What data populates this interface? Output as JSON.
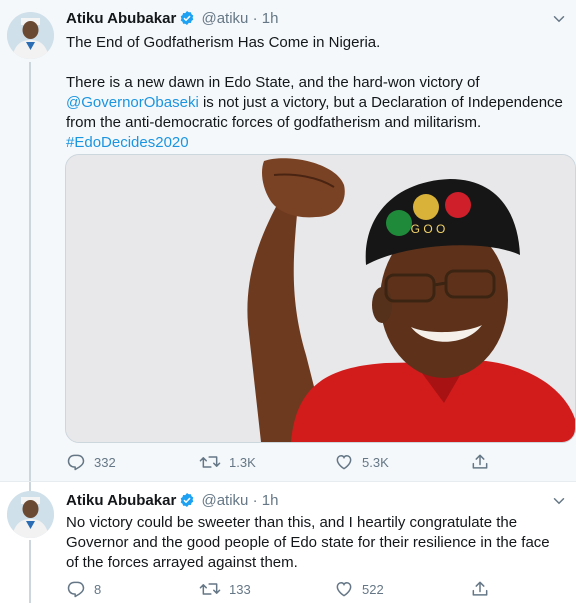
{
  "tweets": [
    {
      "author_name": "Atiku Abubakar",
      "handle": "@atiku",
      "separator": "·",
      "time": "1h",
      "text_line1": "The End of Godfatherism Has Come in Nigeria.",
      "text_p2_a": "There is a new dawn in Edo State, and the hard-won victory of",
      "mention": "@GovernorObaseki",
      "text_p2_b": " is not just a victory, but a Declaration of Independence from the anti-democratic forces of godfatherism and militarism.",
      "hashtag": "#EdoDecides2020",
      "image_cap_text": "G O O",
      "replies": "332",
      "retweets": "1.3K",
      "likes": "5.3K"
    },
    {
      "author_name": "Atiku Abubakar",
      "handle": "@atiku",
      "separator": "·",
      "time": "1h",
      "text": "No victory could be sweeter than this, and I heartily congratulate the Governor and the good people of Edo state for their resilience in the face of the forces arrayed against them.",
      "replies": "8",
      "retweets": "133",
      "likes": "522"
    }
  ],
  "icons": [
    "verified-badge-icon",
    "chevron-down-icon",
    "reply-icon",
    "retweet-icon",
    "like-icon",
    "share-icon"
  ],
  "colors": {
    "link": "#1b95e0",
    "verified": "#1da1f2",
    "muted": "#657786",
    "thread_bg": "#f5f8fa"
  }
}
